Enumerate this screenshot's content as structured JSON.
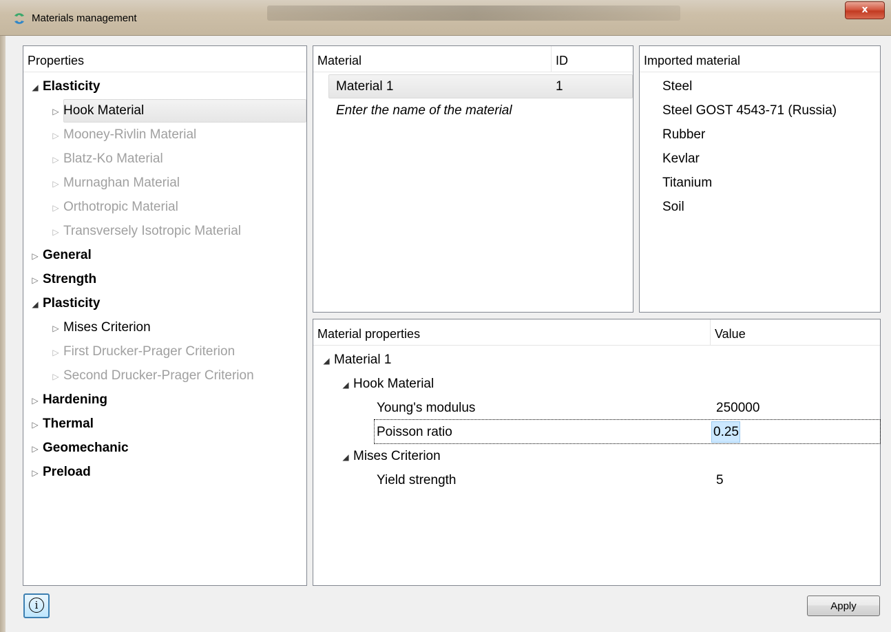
{
  "window": {
    "title": "Materials management",
    "close_label": "x"
  },
  "properties_panel": {
    "header": "Properties",
    "tree": [
      {
        "label": "Elasticity",
        "level": 0,
        "expanded": true,
        "bold": true
      },
      {
        "label": "Hook Material",
        "level": 1,
        "expanded": false,
        "selected": true
      },
      {
        "label": "Mooney-Rivlin Material",
        "level": 1,
        "expanded": false,
        "disabled": true
      },
      {
        "label": "Blatz-Ko Material",
        "level": 1,
        "expanded": false,
        "disabled": true
      },
      {
        "label": "Murnaghan Material",
        "level": 1,
        "expanded": false,
        "disabled": true
      },
      {
        "label": "Orthotropic Material",
        "level": 1,
        "expanded": false,
        "disabled": true
      },
      {
        "label": "Transversely Isotropic Material",
        "level": 1,
        "expanded": false,
        "disabled": true
      },
      {
        "label": "General",
        "level": 0,
        "expanded": false,
        "bold": true
      },
      {
        "label": "Strength",
        "level": 0,
        "expanded": false,
        "bold": true
      },
      {
        "label": "Plasticity",
        "level": 0,
        "expanded": true,
        "bold": true
      },
      {
        "label": "Mises Criterion",
        "level": 1,
        "expanded": false
      },
      {
        "label": "First Drucker-Prager Criterion",
        "level": 1,
        "expanded": false,
        "disabled": true
      },
      {
        "label": "Second Drucker-Prager Criterion",
        "level": 1,
        "expanded": false,
        "disabled": true
      },
      {
        "label": "Hardening",
        "level": 0,
        "expanded": false,
        "bold": true
      },
      {
        "label": "Thermal",
        "level": 0,
        "expanded": false,
        "bold": true
      },
      {
        "label": "Geomechanic",
        "level": 0,
        "expanded": false,
        "bold": true
      },
      {
        "label": "Preload",
        "level": 0,
        "expanded": false,
        "bold": true
      }
    ]
  },
  "materials_panel": {
    "col_material": "Material",
    "col_id": "ID",
    "rows": [
      {
        "name": "Material 1",
        "id": "1"
      }
    ],
    "placeholder": "Enter the name of the material"
  },
  "imported_panel": {
    "header": "Imported material",
    "items": [
      "Steel",
      "Steel GOST 4543-71 (Russia)",
      "Rubber",
      "Kevlar",
      "Titanium",
      "Soil"
    ]
  },
  "material_properties_panel": {
    "col_property": "Material properties",
    "col_value": "Value",
    "material": "Material 1",
    "hook_group": "Hook Material",
    "youngs_label": "Young's modulus",
    "youngs_value": "250000",
    "poisson_label": "Poisson ratio",
    "poisson_value": "0.25",
    "mises_group": "Mises Criterion",
    "yield_label": "Yield strength",
    "yield_value": "5"
  },
  "footer": {
    "info_icon": "i",
    "apply_label": "Apply"
  },
  "icons": {
    "app": "green-blue-swirl-icon",
    "expand": "triangle-right-icon",
    "collapse": "triangle-down-icon",
    "info": "info-circle-icon"
  }
}
